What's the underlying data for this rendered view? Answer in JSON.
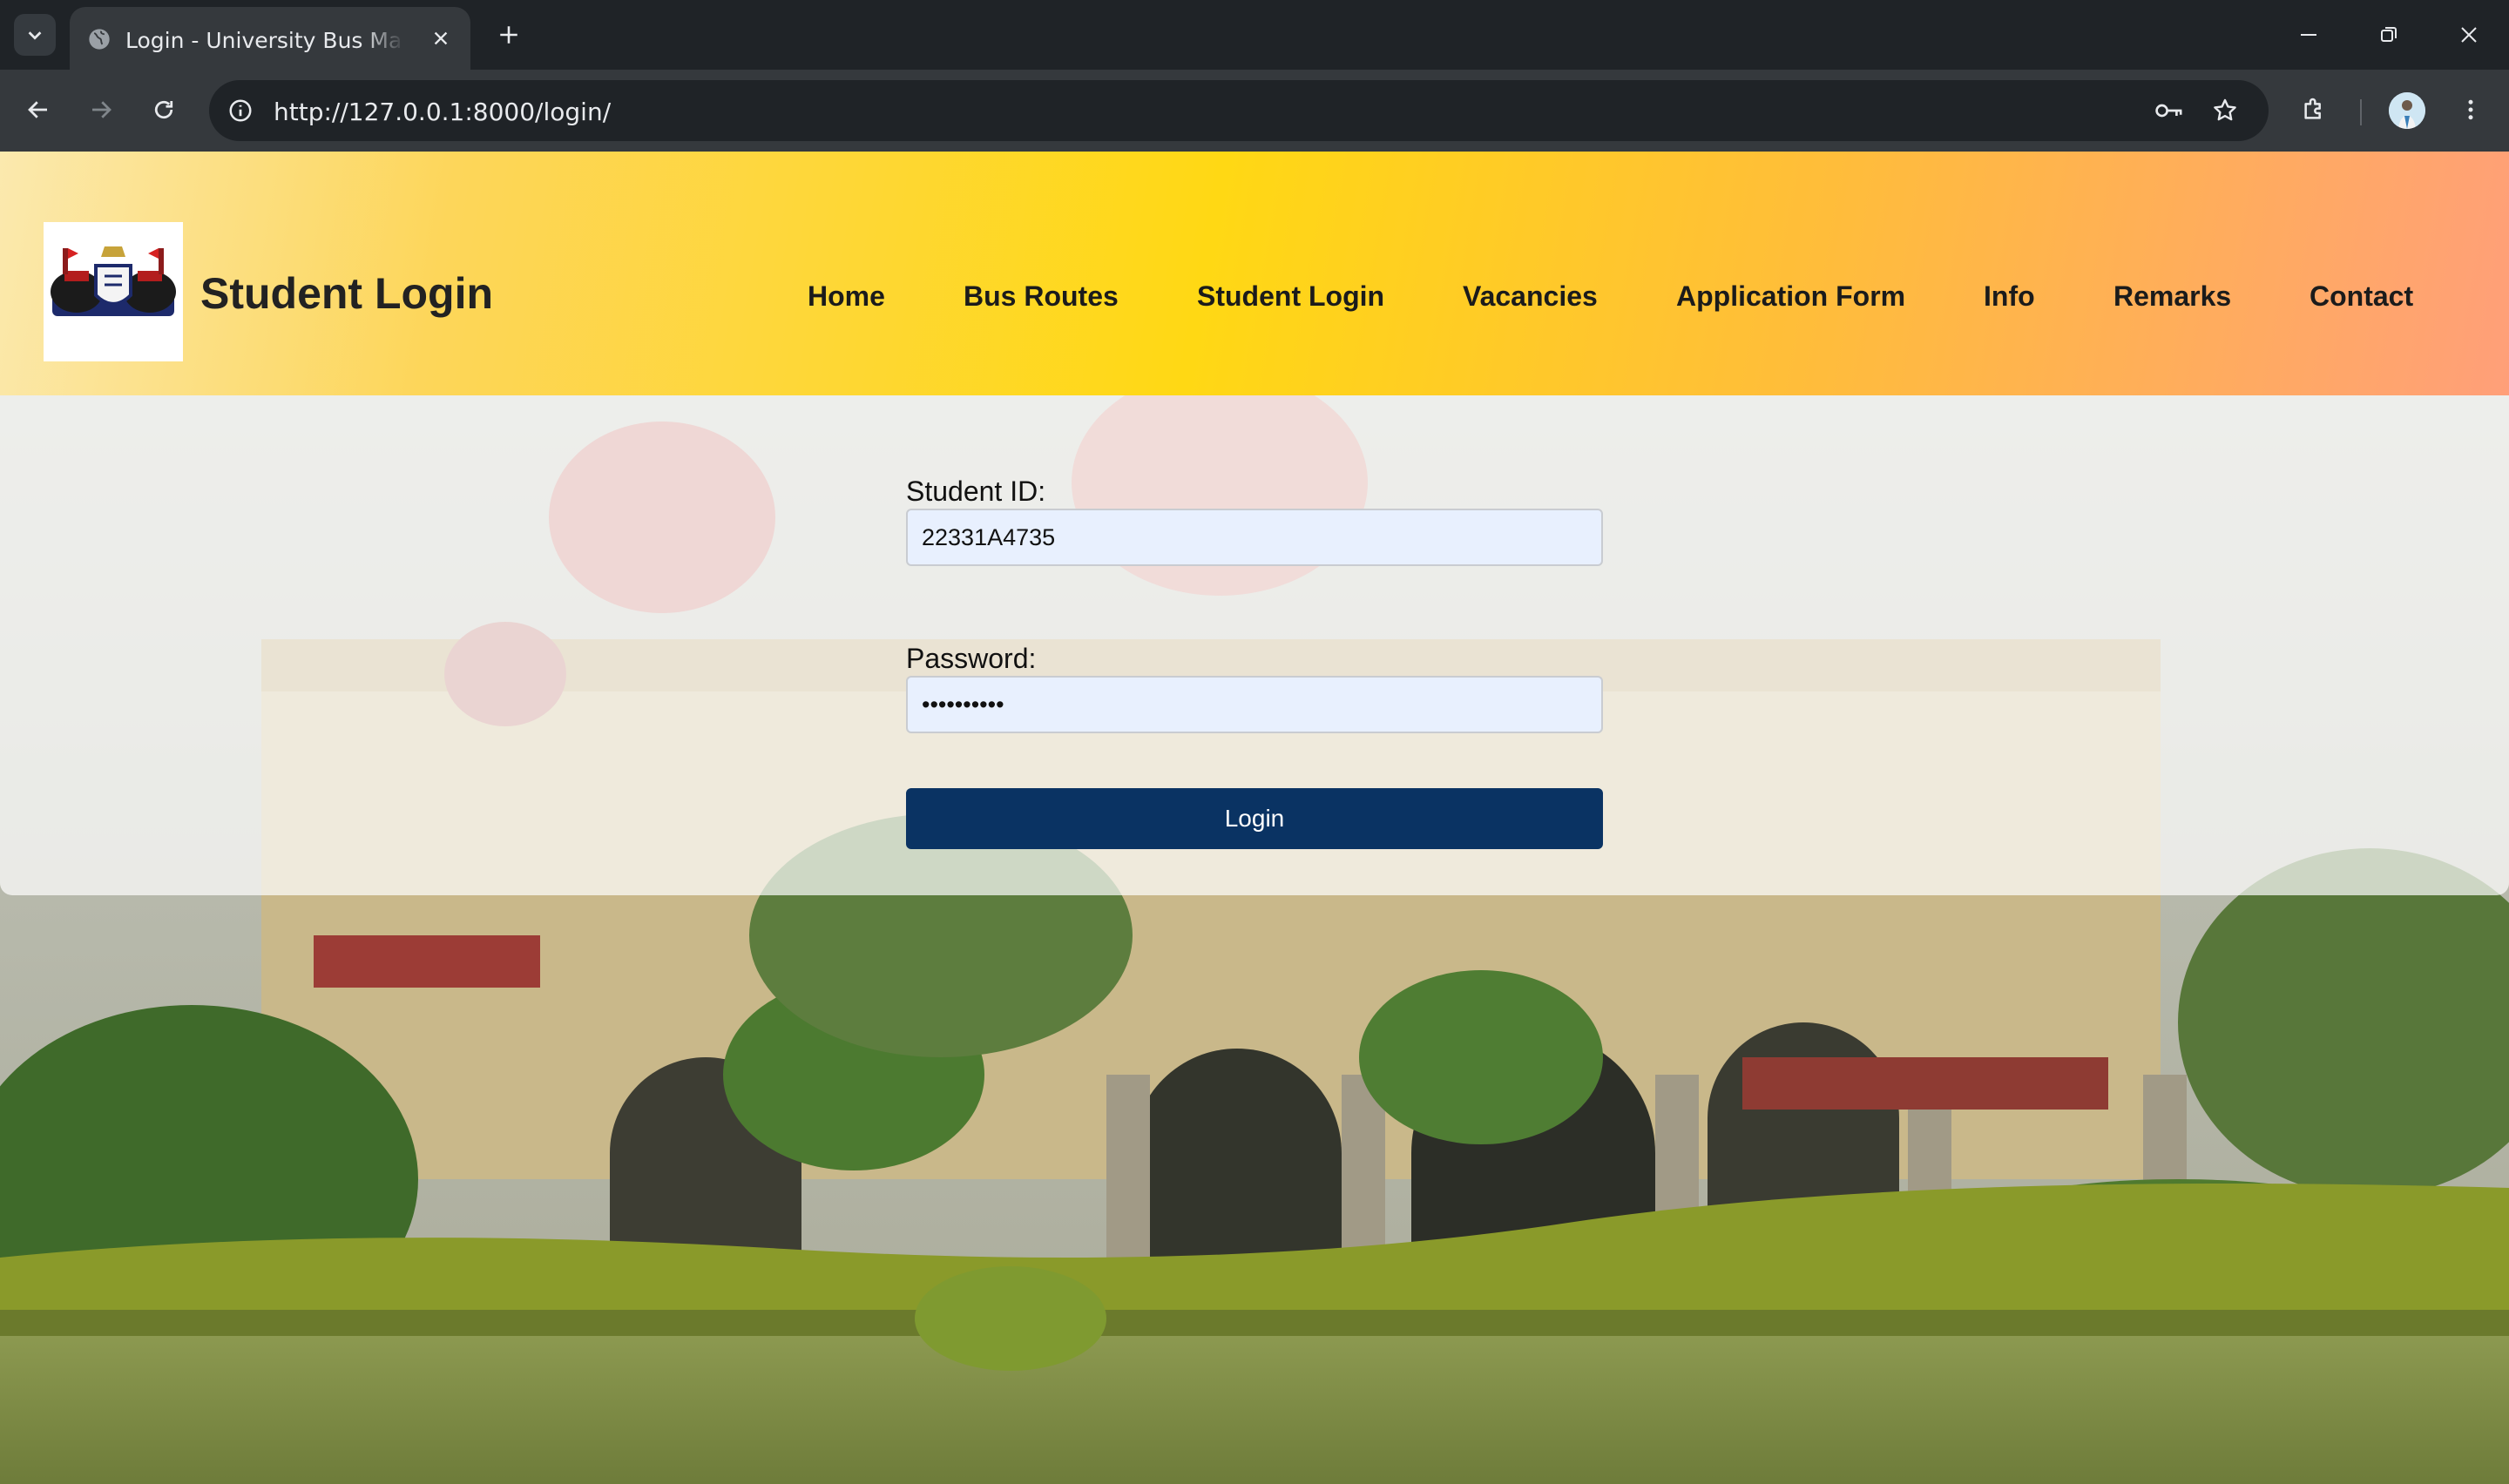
{
  "browser": {
    "tab_title": "Login - University Bus Management",
    "url": "http://127.0.0.1:8000/login/"
  },
  "header": {
    "title": "Student Login",
    "nav": [
      "Home",
      "Bus Routes",
      "Student Login",
      "Vacancies",
      "Application Form",
      "Info",
      "Remarks",
      "Contact"
    ]
  },
  "form": {
    "student_id_label": "Student ID:",
    "student_id_value": "22331A4735",
    "password_label": "Password:",
    "password_value": "••••••••••",
    "login_label": "Login"
  },
  "colors": {
    "header_gradient": [
      "#fbe9ae",
      "#ffd814",
      "#ff9f79"
    ],
    "button": "#0a3363",
    "input_autofill": "#e8f0fe"
  },
  "icons": {
    "tab_list": "chevron-down-icon",
    "favicon": "globe-icon",
    "close": "close-icon",
    "new_tab": "plus-icon",
    "back": "back-arrow-icon",
    "forward": "forward-arrow-icon",
    "reload": "reload-icon",
    "site_info": "info-icon",
    "password": "key-icon",
    "bookmark": "star-icon",
    "extensions": "puzzle-icon",
    "menu": "kebab-menu-icon"
  }
}
